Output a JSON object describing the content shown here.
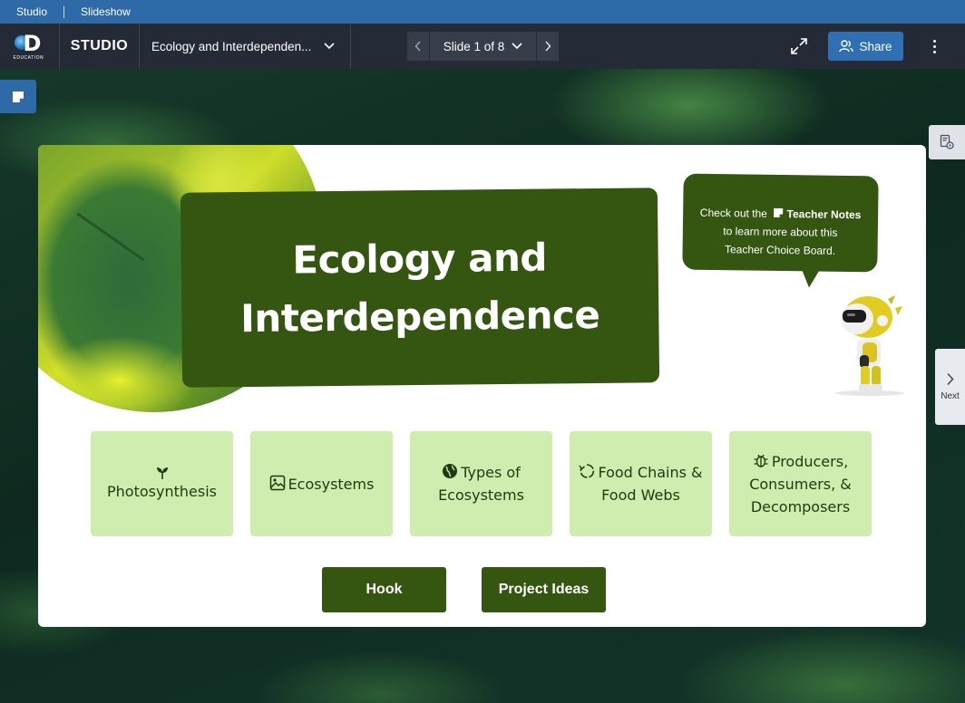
{
  "breadcrumbs": [
    "Studio",
    "Slideshow"
  ],
  "header": {
    "logo_text": "EDUCATION",
    "studio_label": "STUDIO",
    "deck_title": "Ecology and Interdependen...",
    "slide_indicator": "Slide 1 of 8",
    "share_label": "Share"
  },
  "side": {
    "next_label": "Next"
  },
  "slide": {
    "title_line1": "Ecology and",
    "title_line2": "Interdependence",
    "bubble": {
      "prefix": "Check out the",
      "notes_label": "Teacher Notes",
      "line2": "to learn more about this",
      "line3": "Teacher Choice Board."
    },
    "topics": [
      {
        "label": "Photosynthesis",
        "icon": "sprout-icon"
      },
      {
        "label": "Ecosystems",
        "icon": "image-icon"
      },
      {
        "label": "Types of Ecosystems",
        "icon": "globe-icon"
      },
      {
        "label": "Food Chains & Food Webs",
        "icon": "cycle-icon"
      },
      {
        "label": "Producers, Consumers, & Decomposers",
        "icon": "bug-icon"
      }
    ],
    "buttons": {
      "hook": "Hook",
      "project_ideas": "Project Ideas"
    }
  },
  "colors": {
    "dark_green": "#345611",
    "light_green": "#cfedae",
    "header_bg": "#242a36",
    "accent_blue": "#2f6fb2"
  }
}
